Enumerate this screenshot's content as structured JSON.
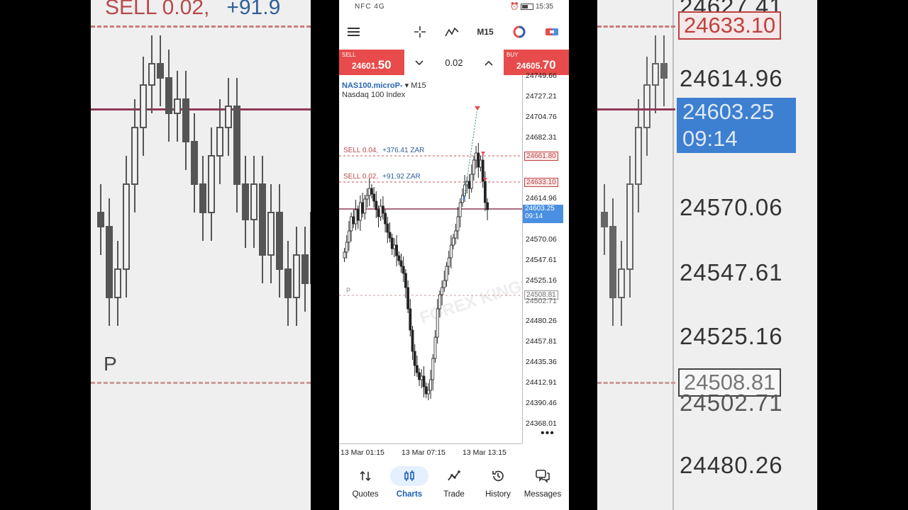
{
  "status_bar": {
    "left_icons": "NFC 4G",
    "time": "15:35"
  },
  "toolbar": {
    "timeframe": "M15"
  },
  "trade_bar": {
    "sell_label": "SELL",
    "sell_price_main": "24601.",
    "sell_price_big": "50",
    "buy_label": "BUY",
    "buy_price_main": "24605.",
    "buy_price_big": "70",
    "volume": "0.02",
    "down_arrow": "⌄",
    "up_arrow": "⌃"
  },
  "chart": {
    "symbol": "NAS100.microP-",
    "symbol_suffix": "▾ M15",
    "description": "Nasdaq 100 Index",
    "watermark_text": "FOREX KINGS",
    "ticks": [
      "24749.66",
      "24727.21",
      "24704.76",
      "24682.31",
      "24614.96",
      "24570.06",
      "24547.61",
      "24525.16",
      "24502.71",
      "24480.26",
      "24457.81",
      "24435.36",
      "24412.91",
      "24390.46",
      "24368.01"
    ],
    "tags": {
      "sell1": "24661.80",
      "sell2": "24633.10",
      "current_price": "24603.25",
      "countdown": "09:14",
      "gray": "24508.81"
    },
    "orders": [
      {
        "text": "SELL 0.04,",
        "pnl": "+376.41 ZAR"
      },
      {
        "text": "SELL 0.02,",
        "pnl": "+91.92 ZAR"
      }
    ],
    "x_labels": [
      "13 Mar 01:15",
      "13 Mar 07:15",
      "13 Mar 13:15"
    ],
    "more": "•••",
    "marker_p": "P"
  },
  "nav": {
    "quotes": "Quotes",
    "charts": "Charts",
    "trade": "Trade",
    "history": "History",
    "messages": "Messages"
  },
  "background": {
    "sell_text": "SELL 0.02,",
    "sell_pnl": "+91.9",
    "prices": [
      "24627.41",
      "24614.96",
      "24570.06",
      "24547.61",
      "24525.16",
      "24502.71",
      "24480.26"
    ],
    "boxes": [
      "24633.10",
      "24603.25",
      "09:14",
      "24508.81"
    ],
    "marker_p": "P"
  },
  "colors": {
    "sell": "#e84b4b",
    "accent": "#1f5fb8",
    "price_tag": "#4a90e2",
    "order_line": "#c85050"
  }
}
